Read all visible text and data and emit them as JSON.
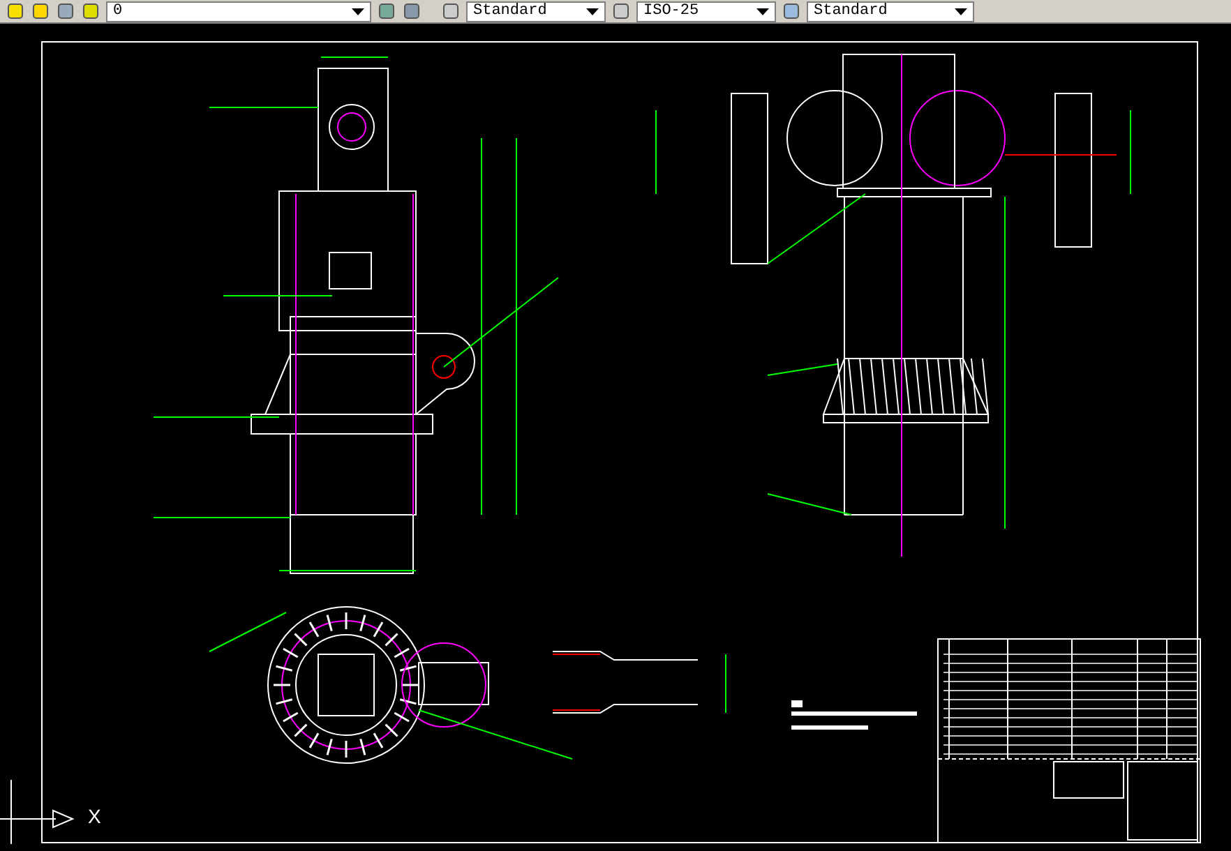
{
  "toolbar": {
    "layer": "0",
    "text_style": "Standard",
    "dim_style": "ISO-25",
    "table_style": "Standard"
  },
  "canvas": {
    "ucs_axis_label": "X"
  }
}
